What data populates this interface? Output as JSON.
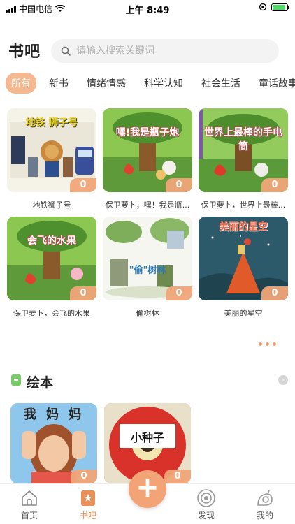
{
  "status_bar": {
    "carrier": "中国电信",
    "time": "上午 8:49"
  },
  "header": {
    "title": "书吧",
    "search_placeholder": "请输入搜索关键词"
  },
  "tabs": [
    {
      "label": "所有",
      "active": true
    },
    {
      "label": "新书",
      "active": false
    },
    {
      "label": "情绪情感",
      "active": false
    },
    {
      "label": "科学认知",
      "active": false
    },
    {
      "label": "社会生活",
      "active": false
    },
    {
      "label": "童话故事",
      "active": false
    }
  ],
  "books": [
    {
      "title": "地铁狮子号",
      "count": "0",
      "cover_text": "地铁 狮子号"
    },
    {
      "title": "保卫萝卜，嘿！我是瓶...",
      "count": "0",
      "cover_text": "嘿!我是瓶子炮"
    },
    {
      "title": "保卫萝卜，世界上最棒...",
      "count": "0",
      "cover_text": "世界上最棒的手电筒"
    },
    {
      "title": "保卫萝卜，会飞的水果",
      "count": "0",
      "cover_text": "会飞的水果"
    },
    {
      "title": "偷树林",
      "count": "0",
      "cover_text": "\"偷\"树林"
    },
    {
      "title": "美丽的星空",
      "count": "0",
      "cover_text": "美丽的星空"
    }
  ],
  "section": {
    "title": "绘本"
  },
  "picture_books": [
    {
      "cover_text": "我 妈 妈",
      "count": "0"
    },
    {
      "cover_text": "小种子",
      "count": "0"
    }
  ],
  "tabbar": {
    "home": "首页",
    "bookbar": "书吧",
    "discover": "发现",
    "mine": "我的",
    "add": "+"
  },
  "colors": {
    "accent": "#f2a477",
    "active_text": "#e8915b",
    "tab_active_bg": "#f5b88f"
  }
}
